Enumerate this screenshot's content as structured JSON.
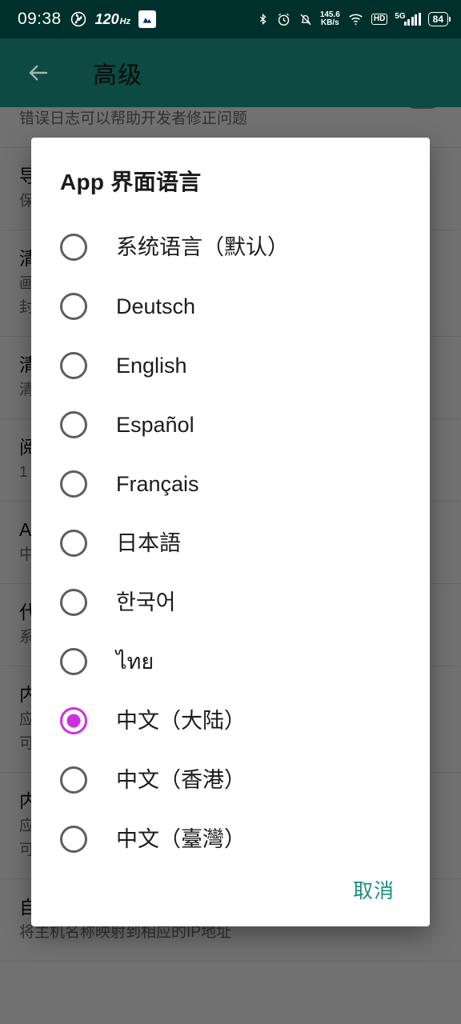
{
  "status_bar": {
    "clock": "09:38",
    "refresh_rate": "120",
    "refresh_rate_unit": "Hz",
    "network_speed_value": "145.6",
    "network_speed_unit": "KB/s",
    "hd_label": "HD",
    "network_type": "5G",
    "battery_level": "84",
    "icons": [
      "fan-icon",
      "app-badge-icon",
      "bluetooth-icon",
      "alarm-icon",
      "notification-muted-icon",
      "wifi-icon",
      "signal-bars-icon"
    ],
    "background_color": "#00302b"
  },
  "app_bar": {
    "title": "高级",
    "back_icon": "arrow-left-icon",
    "background_color": "#0d4a43"
  },
  "background_list": {
    "rows": [
      {
        "title": "",
        "sub": "错误日志可以帮助开发者修正问题",
        "has_switch": true
      },
      {
        "title": "导出日志",
        "sub": "保存日志到文件",
        "has_switch": false
      },
      {
        "title": "清理缓存",
        "sub": "画面缓存占用空间",
        "sub2": "封面等静态资源缓存",
        "has_switch": false
      },
      {
        "title": "清空数据库",
        "sub": "清除所有本地记录",
        "has_switch": false
      },
      {
        "title": "阅读历史记录",
        "sub": "1",
        "has_switch": false
      },
      {
        "title": "App 界面语言",
        "sub": "中文（大陆）",
        "has_switch": false
      },
      {
        "title": "代理设置",
        "sub": "系统代理",
        "has_switch": false
      },
      {
        "title": "内置 hosts.txt",
        "sub": "应用内置的域名解析表",
        "sub2": "可被自定义 hosts.txt 覆盖",
        "has_switch": false
      },
      {
        "title": "内置 hosts.txt",
        "sub": "应用内置的域名解析表",
        "sub2": "可被自定义 hosts.txt 覆盖",
        "has_switch": false
      },
      {
        "title": "自定义 hosts.txt",
        "sub": "将主机名称映射到相应的IP地址",
        "has_switch": false
      }
    ]
  },
  "dialog": {
    "title": "App 界面语言",
    "selected_index": 8,
    "accent_color": "#cf2fdf",
    "options": [
      {
        "label": "系统语言（默认）",
        "selected": false
      },
      {
        "label": "Deutsch",
        "selected": false
      },
      {
        "label": "English",
        "selected": false
      },
      {
        "label": "Español",
        "selected": false
      },
      {
        "label": "Français",
        "selected": false
      },
      {
        "label": "日本語",
        "selected": false
      },
      {
        "label": "한국어",
        "selected": false
      },
      {
        "label": "ไทย",
        "selected": false
      },
      {
        "label": "中文（大陆）",
        "selected": true
      },
      {
        "label": "中文（香港）",
        "selected": false
      },
      {
        "label": "中文（臺灣）",
        "selected": false
      }
    ],
    "cancel_label": "取消",
    "cancel_color": "#1a8f7e"
  }
}
